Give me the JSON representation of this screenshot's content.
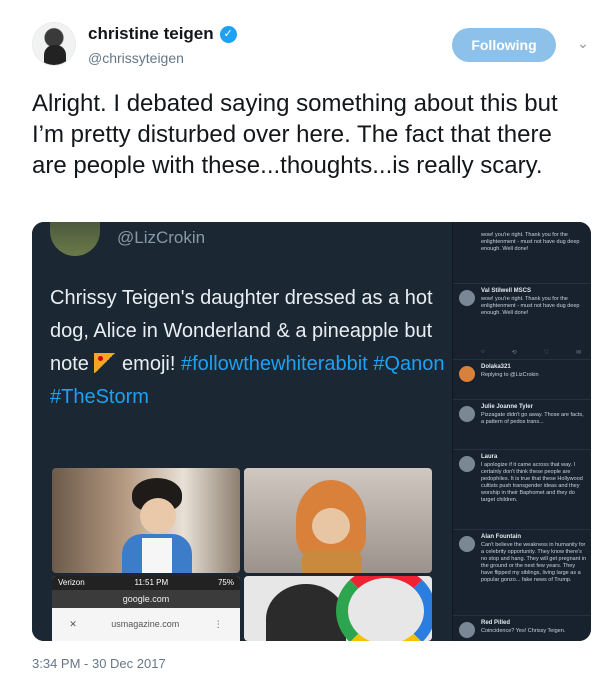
{
  "author": {
    "name": "christine teigen",
    "handle": "@chrissyteigen",
    "verified_icon": "verified-badge-icon",
    "follow_label": "Following"
  },
  "tweet": {
    "text": "Alright. I debated saying something about this but I’m pretty disturbed over here. The fact that there are people with these...thoughts...is really scary.",
    "timestamp": "3:34 PM - 30 Dec 2017"
  },
  "media": {
    "embed_handle": "@LizCrokin",
    "embed_text_1": "Chrissy Teigen's daughter dressed as a hot dog, Alice in Wonderland & a pineapple but note ",
    "embed_text_2": " emoji! ",
    "embed_tags": "#followthewhiterabbit #Qanon #TheStorm",
    "phone": {
      "carrier": "Verizon",
      "time": "11:51 PM",
      "battery": "75%",
      "url": "google.com",
      "page": "usmagazine.com"
    },
    "replies": [
      {
        "name": "Val Stilwell MSCS",
        "text": "wow! you're right. Thank you for the enlightenment - must not have dug deep enough. Well done!"
      },
      {
        "name": "Dolaka321",
        "text": "Replying to @LizCrokin"
      },
      {
        "name": "Julie Joanne Tyler",
        "text": "Pizzagate didn't go away. Those are facts, a pattern of pedos trans..."
      },
      {
        "name": "Laura",
        "text": "I apologize if it came across that way. I certainly don't think these people are pedophiles. It is true that these Hollywood cultists push transgender ideas and they worship in their Baphomet and they do target children."
      },
      {
        "name": "Alan Fountain",
        "text": "Can't believe the weakness in humanity for a celebrity opportunity. They know there's no stop and hang. They will get pregnant in the ground or the next few years. They have flipped my siblings, living large as a popular gonzo... fake news of Trump."
      },
      {
        "name": "Red Pilled",
        "text": "Coincidence? Yes! Chrissy Teigen."
      }
    ]
  }
}
